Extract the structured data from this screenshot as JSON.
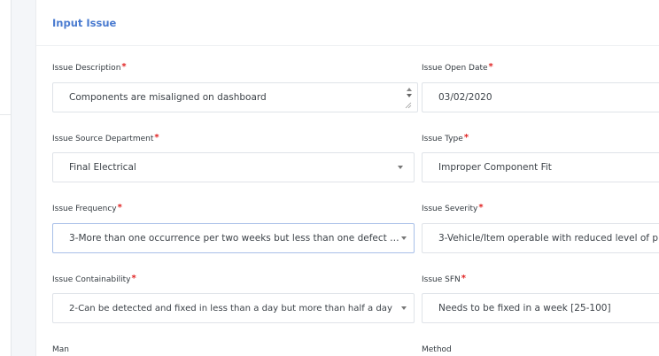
{
  "panel": {
    "title": "Input Issue"
  },
  "fields": {
    "issue_description": {
      "label": "Issue Description",
      "value": "Components are misaligned on dashboard"
    },
    "issue_open_date": {
      "label": "Issue Open Date",
      "value": "03/02/2020"
    },
    "issue_source_department": {
      "label": "Issue Source Department",
      "value": "Final Electrical"
    },
    "issue_type": {
      "label": "Issue Type",
      "value": "Improper Component Fit"
    },
    "issue_frequency": {
      "label": "Issue Frequency",
      "value": "3-More than one occurrence per two weeks but less than one defect p..."
    },
    "issue_severity": {
      "label": "Issue Severity",
      "value": "3-Vehicle/Item operable with reduced level of p"
    },
    "issue_containability": {
      "label": "Issue Containability",
      "value": "2-Can be detected and fixed in less than a day but more than half a day"
    },
    "issue_sfn": {
      "label": "Issue SFN",
      "value": "Needs to be fixed in a week [25-100]"
    },
    "man": {
      "label": "Man"
    },
    "method": {
      "label": "Method"
    }
  },
  "required_marker": "*",
  "icons": {
    "dropdown": "chevron-down-icon",
    "spinner": "spinner-arrows-icon",
    "resize": "resize-grip-icon"
  },
  "colors": {
    "title": "#4a7bd0",
    "required": "#e02020",
    "focus_border": "#a8bfe8"
  }
}
